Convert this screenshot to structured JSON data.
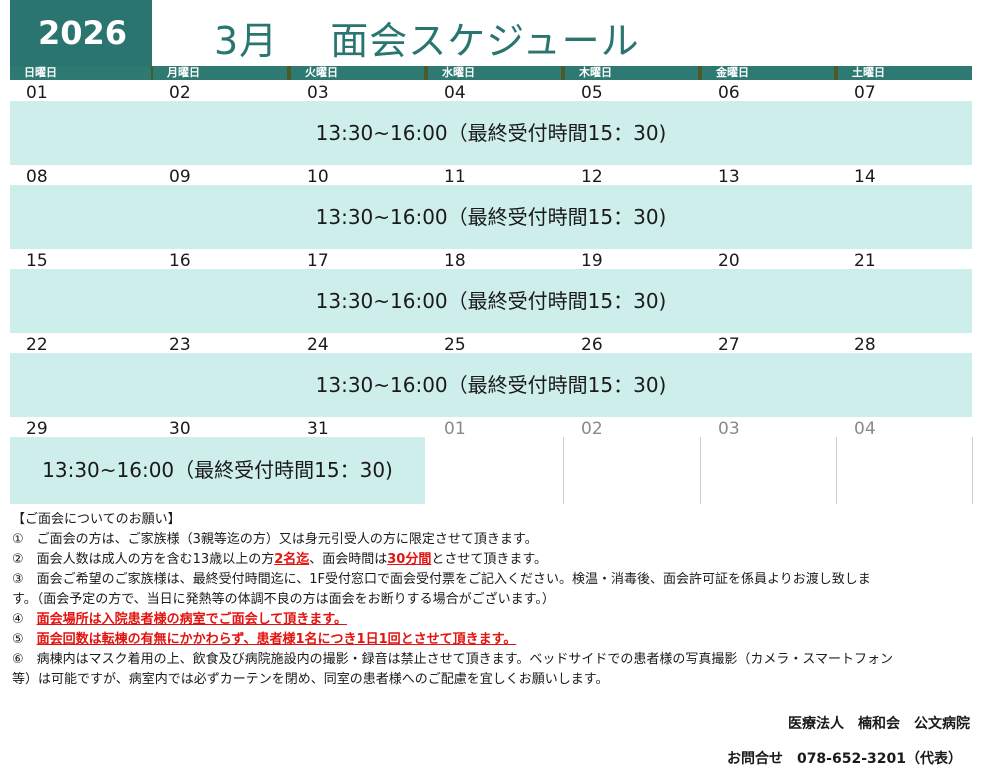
{
  "header": {
    "year": "2026",
    "title": "3月　 面会スケジュール"
  },
  "weekdays": [
    "日曜日",
    "月曜日",
    "火曜日",
    "水曜日",
    "木曜日",
    "金曜日",
    "土曜日"
  ],
  "weeks": [
    {
      "dates": [
        "01",
        "02",
        "03",
        "04",
        "05",
        "06",
        "07"
      ],
      "hours": "13:30~16:00（最終受付時間15：30)"
    },
    {
      "dates": [
        "08",
        "09",
        "10",
        "11",
        "12",
        "13",
        "14"
      ],
      "hours": "13:30~16:00（最終受付時間15：30)"
    },
    {
      "dates": [
        "15",
        "16",
        "17",
        "18",
        "19",
        "20",
        "21"
      ],
      "hours": "13:30~16:00（最終受付時間15：30)"
    },
    {
      "dates": [
        "22",
        "23",
        "24",
        "25",
        "26",
        "27",
        "28"
      ],
      "hours": "13:30~16:00（最終受付時間15：30)"
    },
    {
      "dates": [
        "29",
        "30",
        "31"
      ],
      "next_month_dates": [
        "01",
        "02",
        "03",
        "04"
      ],
      "hours": "13:30~16:00（最終受付時間15：30)"
    }
  ],
  "notes": {
    "heading": "【ご面会についてのお願い】",
    "n1": "①　ご面会の方は、ご家族様（3親等迄の方）又は身元引受人の方に限定させて頂きます。",
    "n2_a": "②　面会人数は成人の方を含む13歳以上の方",
    "n2_b": "2名迄",
    "n2_c": "、面会時間は",
    "n2_d": "30分間",
    "n2_e": "とさせて頂きます。",
    "n3_a": "③　面会ご希望のご家族様は、最終受付時間迄に、1F受付窓口で面会受付票をご記入ください。検温・消毒後、面会許可証を係員よりお渡し致しま",
    "n3_b": "す。（面会予定の方で、当日に発熱等の体調不良の方は面会をお断りする場合がございます。）",
    "n4_num": "④　",
    "n4_text": "面会場所は入院患者様の病室でご面会して頂きます。",
    "n5_num": "⑤　",
    "n5_text": "面会回数は転棟の有無にかかわらず、患者様1名につき1日1回とさせて頂きます。",
    "n6_a": "⑥　病棟内はマスク着用の上、飲食及び病院施設内の撮影・録音は禁止させて頂きます。ベッドサイドでの患者様の写真撮影（カメラ・スマートフォン",
    "n6_b": "等）は可能ですが、病室内では必ずカーテンを閉め、同室の患者様へのご配慮を宜しくお願いします。"
  },
  "footer": {
    "org": "医療法人　楠和会　公文病院",
    "contact": "お問合せ　078-652-3201（代表）"
  },
  "colors": {
    "brand": "#2a7570",
    "header_bar": "#4b5a27",
    "band": "#cdeeea",
    "alert": "#e3130f"
  }
}
